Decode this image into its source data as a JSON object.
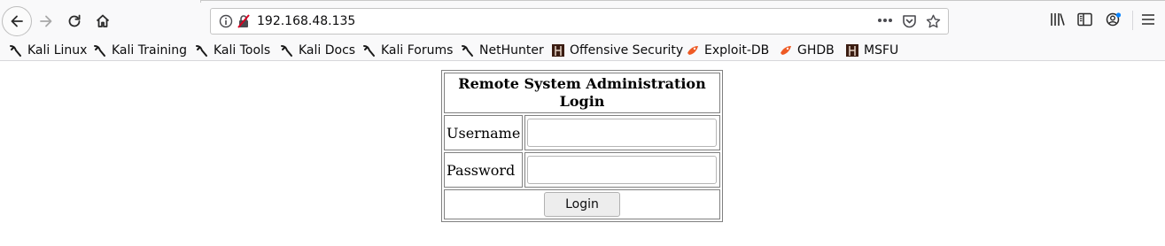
{
  "browser": {
    "url": "192.168.48.135",
    "bookmarks": [
      {
        "label": "Kali Linux",
        "icon": "kali-dragon-icon"
      },
      {
        "label": "Kali Training",
        "icon": "kali-dragon-icon"
      },
      {
        "label": "Kali Tools",
        "icon": "kali-dragon-icon"
      },
      {
        "label": "Kali Docs",
        "icon": "kali-dragon-icon"
      },
      {
        "label": "Kali Forums",
        "icon": "kali-dragon-icon"
      },
      {
        "label": "NetHunter",
        "icon": "kali-dragon-icon"
      },
      {
        "label": "Offensive Security",
        "icon": "offsec-icon"
      },
      {
        "label": "Exploit-DB",
        "icon": "exploit-db-icon"
      },
      {
        "label": "GHDB",
        "icon": "exploit-db-icon"
      },
      {
        "label": "MSFU",
        "icon": "offsec-icon"
      }
    ],
    "colors": {
      "accent_red": "#d70022",
      "dot_blue": "#0a84ff",
      "exploit_orange": "#ee5a24"
    }
  },
  "login": {
    "title": "Remote System Administration Login",
    "username_label": "Username",
    "password_label": "Password",
    "username_value": "",
    "password_value": "",
    "button_label": "Login"
  }
}
